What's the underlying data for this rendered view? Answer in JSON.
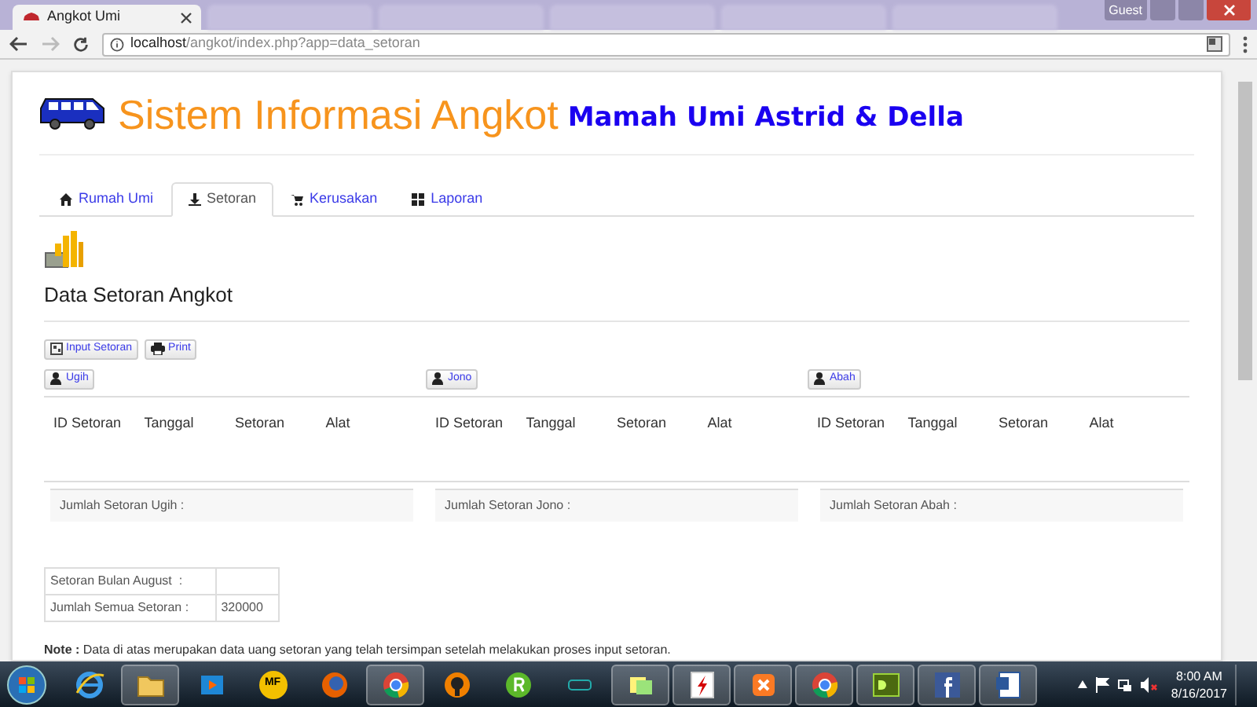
{
  "browser": {
    "tab": {
      "title": "Angkot Umi",
      "selected": true
    },
    "profile": "Guest",
    "url": {
      "host": "localhost",
      "path": "/angkot/index.php?app=data_setoran"
    }
  },
  "header": {
    "title": "Sistem Informasi Angkot",
    "subtitle": "Mamah Umi Astrid & Della"
  },
  "nav_tabs": [
    {
      "label": "Rumah Umi",
      "selected": false
    },
    {
      "label": "Setoran",
      "selected": true
    },
    {
      "label": "Kerusakan",
      "selected": false
    },
    {
      "label": "Laporan",
      "selected": false
    }
  ],
  "heading": "Data Setoran Angkot",
  "actions": [
    {
      "label": "Input Setoran"
    },
    {
      "label": "Print"
    }
  ],
  "drivers": [
    {
      "name": "Ugih",
      "columns": [
        "ID Setoran",
        "Tanggal",
        "Setoran",
        "Alat"
      ],
      "total_label": "Jumlah Setoran Ugih :"
    },
    {
      "name": "Jono",
      "columns": [
        "ID Setoran",
        "Tanggal",
        "Setoran",
        "Alat"
      ],
      "total_label": "Jumlah Setoran Jono :"
    },
    {
      "name": "Abah",
      "columns": [
        "ID Setoran",
        "Tanggal",
        "Setoran",
        "Alat"
      ],
      "total_label": "Jumlah Setoran Abah :"
    }
  ],
  "summary": [
    {
      "label": "Setoran Bulan August  :"
    },
    {
      "label": "Jumlah Semua Setoran :",
      "value": "320000"
    }
  ],
  "note": "**Note :** Data di atas merupakan data uang setoran yang telah tersimpan setelah melakukan proses input setoran.",
  "taskbar": {
    "apps": [
      {
        "kind": "ie",
        "running": false
      },
      {
        "kind": "folder",
        "running": true
      },
      {
        "kind": "media",
        "running": false
      },
      {
        "kind": "mf",
        "label": "MF",
        "running": false
      },
      {
        "kind": "firefox",
        "running": false
      },
      {
        "kind": "chrome",
        "running": true
      },
      {
        "kind": "keyhole",
        "running": false
      },
      {
        "kind": "r",
        "running": false
      },
      {
        "kind": "nox",
        "running": false
      },
      {
        "kind": "notes",
        "running": true
      },
      {
        "kind": "flash",
        "running": true
      },
      {
        "kind": "xampp",
        "running": true
      },
      {
        "kind": "chrome",
        "running": true
      },
      {
        "kind": "dw",
        "running": true
      },
      {
        "kind": "fb",
        "running": true
      },
      {
        "kind": "word",
        "running": true
      }
    ],
    "time": "8:00 AM",
    "date": "8/16/2017"
  }
}
